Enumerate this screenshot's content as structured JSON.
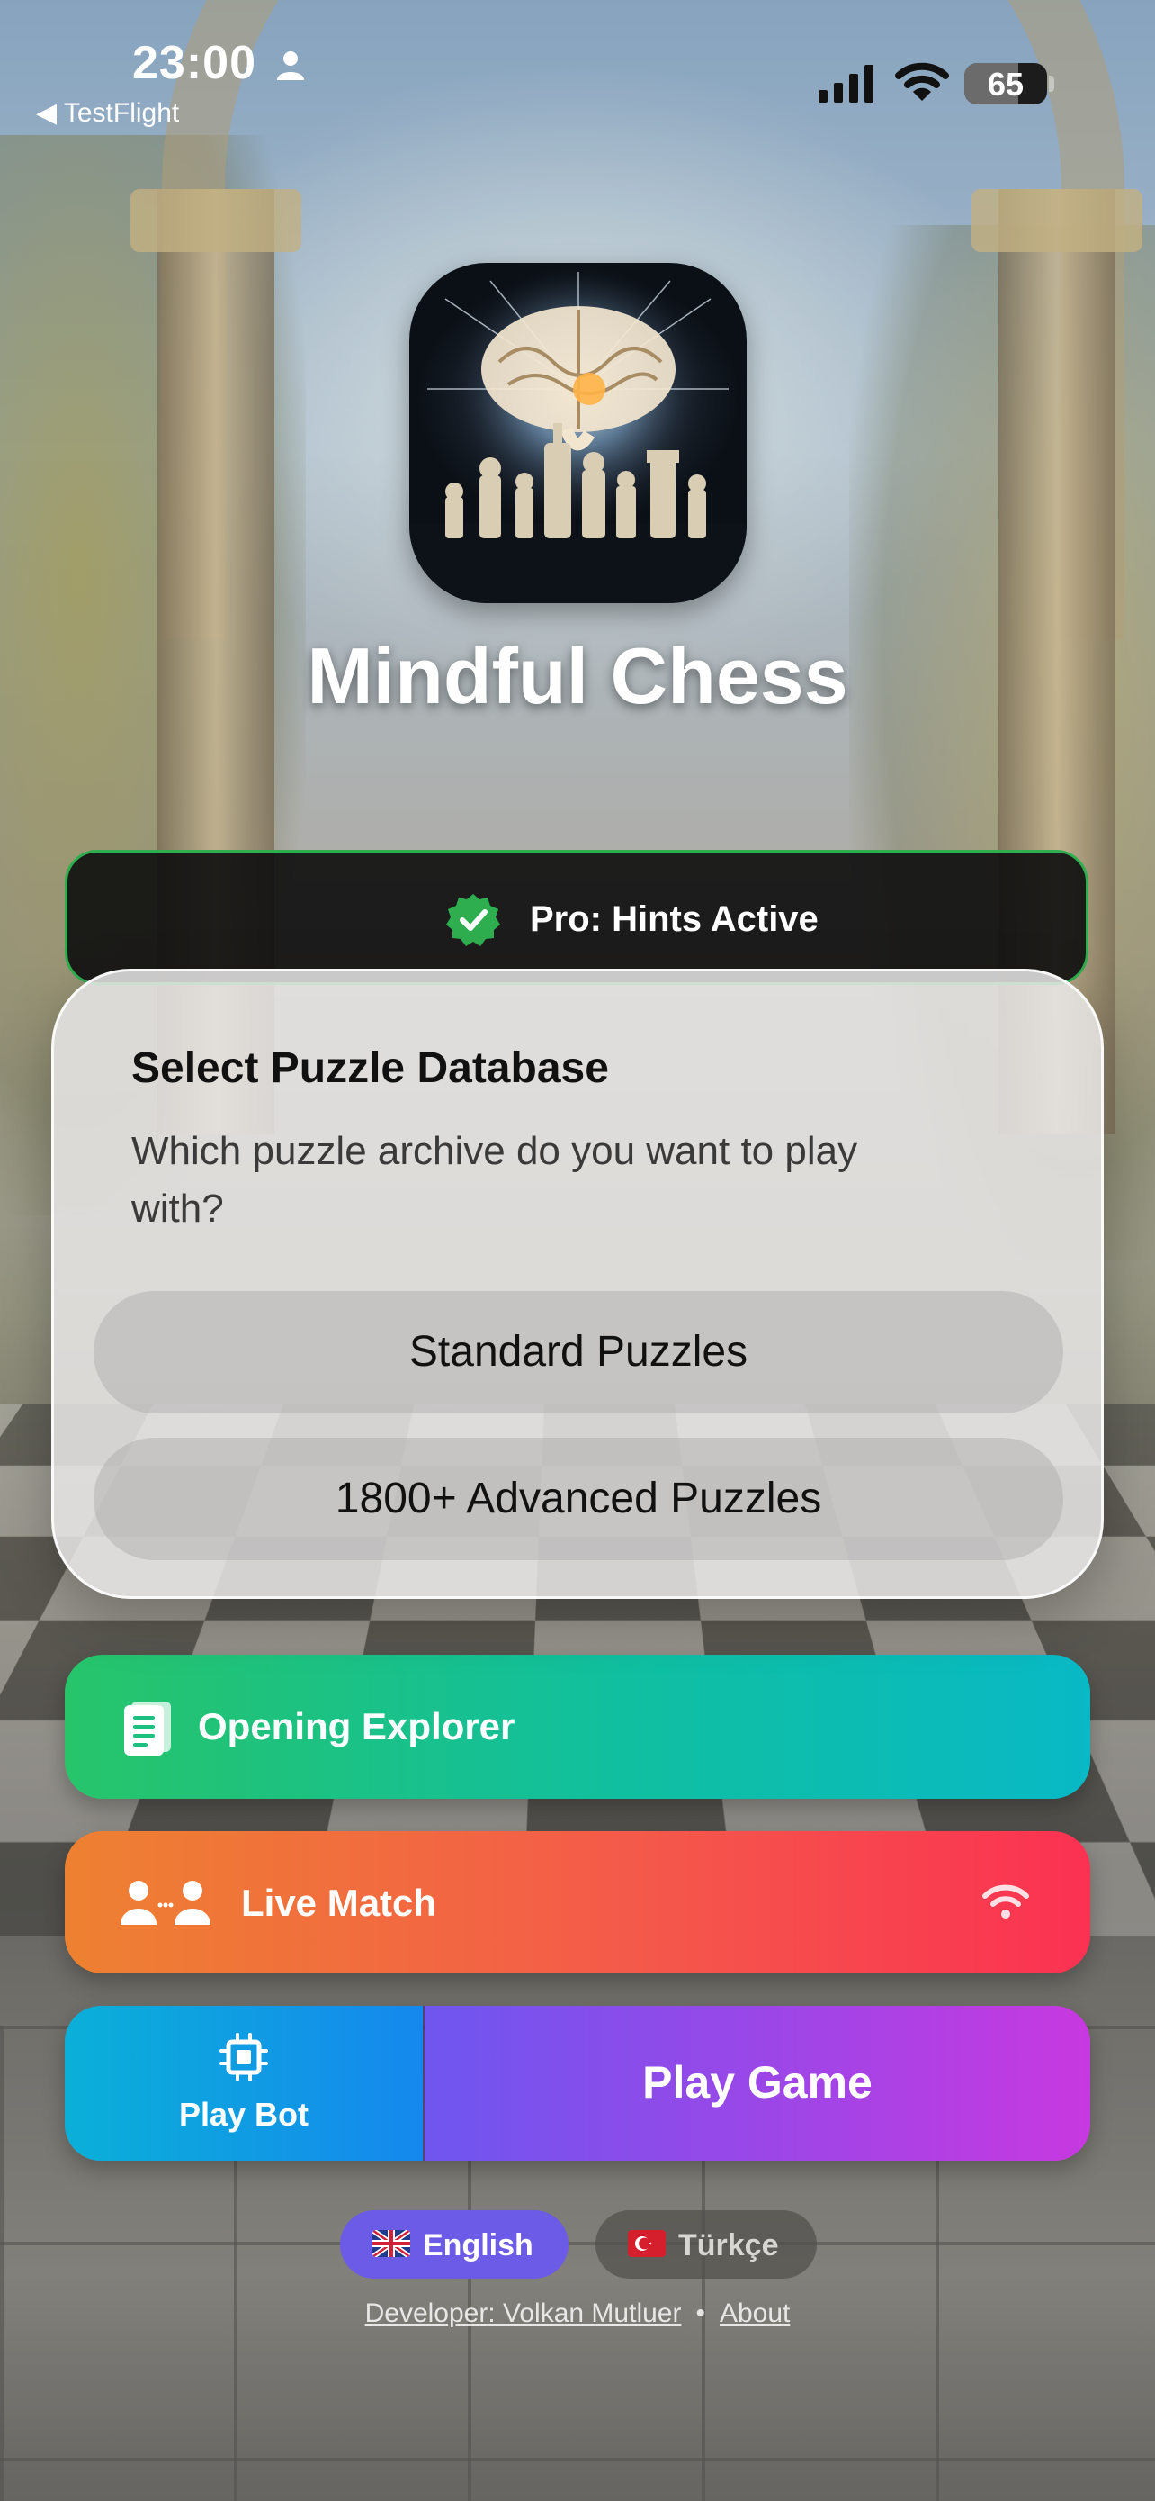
{
  "status_bar": {
    "time": "23:00",
    "back_app": "◀ TestFlight",
    "battery": "65",
    "battery_level": 0.65
  },
  "app": {
    "title": "Mindful Chess"
  },
  "pro_badge": {
    "label": "Pro: Hints Active",
    "icon": "checkmark-seal-icon",
    "accent": "#2fae4f"
  },
  "dialog": {
    "title": "Select Puzzle Database",
    "message": "Which puzzle archive do you want to play with?",
    "options": [
      {
        "label": "Standard Puzzles"
      },
      {
        "label": "1800+ Advanced Puzzles"
      }
    ]
  },
  "buttons": {
    "opening_explorer": {
      "label": "Opening Explorer",
      "icon": "book-icon"
    },
    "live_match": {
      "label": "Live Match",
      "icon": "people-icon",
      "status_icon": "wifi-icon"
    },
    "play_bot": {
      "label": "Play Bot",
      "icon": "chip-icon"
    },
    "play_game": {
      "label": "Play Game"
    }
  },
  "languages": [
    {
      "label": "English",
      "flag": "🇬🇧",
      "selected": true
    },
    {
      "label": "Türkçe",
      "flag": "🇹🇷",
      "selected": false
    }
  ],
  "footer": {
    "developer": "Developer: Volkan Mutluer",
    "separator": "•",
    "about": "About"
  }
}
